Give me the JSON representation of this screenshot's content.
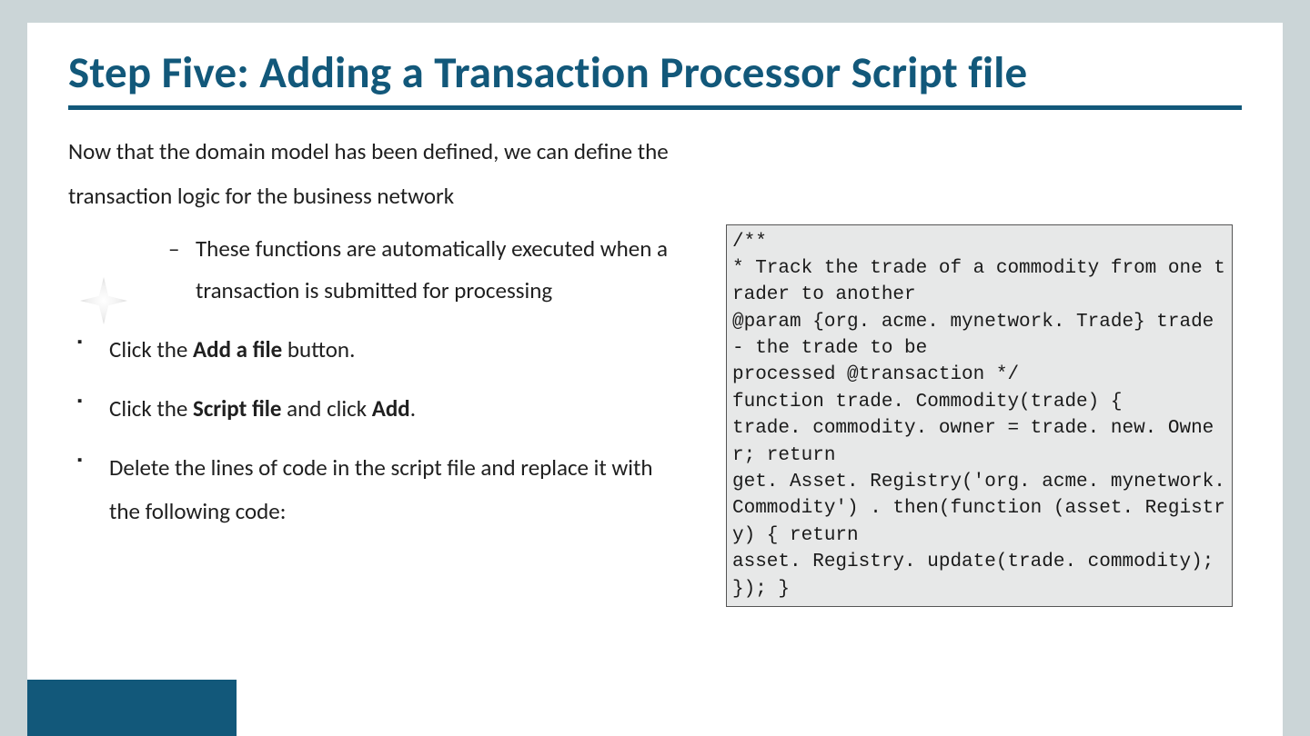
{
  "title": "Step Five: Adding a Transaction Processor Script file",
  "intro": "Now that the domain model has been defined, we can define the transaction logic for the business network",
  "subpoint": "These functions are automatically executed when a transaction is submitted for processing",
  "steps": {
    "s1_a": "Click the ",
    "s1_b": "Add a file",
    "s1_c": " button.",
    "s2_a": "Click the ",
    "s2_b": "Script file",
    "s2_c": " and click ",
    "s2_d": "Add",
    "s2_e": ".",
    "s3": "Delete the lines of code in the script file and replace it with the following code:"
  },
  "code": "/**\n* Track the trade of a commodity from one trader to another\n@param {org. acme. mynetwork. Trade} trade - the trade to be\nprocessed @transaction */\nfunction trade. Commodity(trade) {\ntrade. commodity. owner = trade. new. Owner; return\nget. Asset. Registry('org. acme. mynetwork. Commodity') . then(function (asset. Registry) { return\nasset. Registry. update(trade. commodity); }); }"
}
